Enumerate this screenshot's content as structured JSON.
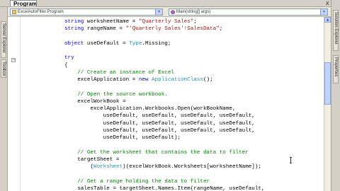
{
  "tabs": {
    "active_tab": "Program.cs*",
    "close_glyph": "x"
  },
  "navigation": {
    "class_combo": "ExcelAutoFilter.Program",
    "member_combo": "Main(string[] args)"
  },
  "left_panels": [
    "Server Explorer",
    "Toolbox"
  ],
  "right_panels": [
    "Solution Explorer",
    "Properties"
  ],
  "editor": {
    "lines": [
      [
        {
          "t": "string",
          "c": "kw"
        },
        {
          "t": " worksheetName = "
        },
        {
          "t": "\"Quarterly Sales\"",
          "c": "st"
        },
        {
          "t": ";"
        }
      ],
      [
        {
          "t": "string",
          "c": "kw"
        },
        {
          "t": " rangeName = "
        },
        {
          "t": "\"'Quarterly Sales'!SalesData\"",
          "c": "st"
        },
        {
          "t": ";"
        }
      ],
      [],
      [
        {
          "t": "object",
          "c": "kw"
        },
        {
          "t": " useDefault = "
        },
        {
          "t": "Type",
          "c": "ty"
        },
        {
          "t": ".Missing;"
        }
      ],
      [],
      [
        {
          "t": "try",
          "c": "kw"
        }
      ],
      [
        {
          "t": "{"
        }
      ],
      [
        {
          "t": "    "
        },
        {
          "t": "// Create an instance of Excel",
          "c": "cm"
        }
      ],
      [
        {
          "t": "    excelApplication = "
        },
        {
          "t": "new",
          "c": "kw"
        },
        {
          "t": " "
        },
        {
          "t": "ApplicationClass",
          "c": "ty"
        },
        {
          "t": "();"
        }
      ],
      [],
      [
        {
          "t": "    "
        },
        {
          "t": "// Open the source workbook.",
          "c": "cm"
        }
      ],
      [
        {
          "t": "    excelWorkBook ="
        }
      ],
      [
        {
          "t": "        excelApplication.Workbooks.Open(workBookName,"
        }
      ],
      [
        {
          "t": "            useDefault, useDefault, useDefault, useDefault,"
        }
      ],
      [
        {
          "t": "            useDefault, useDefault, useDefault, useDefault,"
        }
      ],
      [
        {
          "t": "            useDefault, useDefault, useDefault, useDefault,"
        }
      ],
      [
        {
          "t": "            useDefault, useDefault);"
        }
      ],
      [],
      [
        {
          "t": "    "
        },
        {
          "t": "// Get the worksheet that contains the data to filter",
          "c": "cm"
        }
      ],
      [
        {
          "t": "    targetSheet ="
        }
      ],
      [
        {
          "t": "        ("
        },
        {
          "t": "Worksheet",
          "c": "ty"
        },
        {
          "t": ")(excelWorkBook.Worksheets[worksheetName]);"
        }
      ],
      [],
      [
        {
          "t": "    "
        },
        {
          "t": "// Get a range holding the data to filter",
          "c": "cm"
        }
      ],
      [
        {
          "t": "    salesTable = targetSheet.Names.Item(rangeName, useDefault,"
        }
      ]
    ]
  },
  "colors": {
    "keyword": "#0000ff",
    "comment": "#008000",
    "string": "#a31515",
    "type": "#2b91af"
  }
}
